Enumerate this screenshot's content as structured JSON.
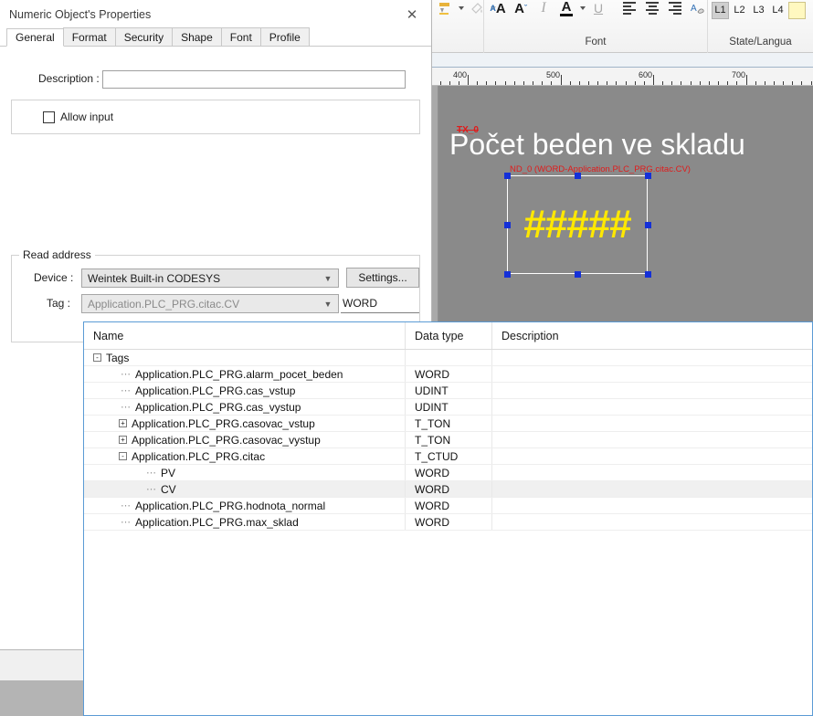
{
  "ribbon": {
    "groups": [
      {
        "label": "",
        "icons": [
          "highlight-color-icon",
          "fill-color-icon"
        ]
      },
      {
        "label": "Font",
        "icons": [
          "increase-font-size-icon",
          "decrease-font-size-icon",
          "italic-icon",
          "font-color-icon",
          "underline-icon",
          "align-left-icon",
          "align-center-icon",
          "align-right-icon",
          "format-painter-icon"
        ]
      },
      {
        "label": "State/Langua",
        "icons": [
          "L1",
          "L2",
          "L3",
          "L4"
        ]
      }
    ],
    "font_group_label": "Font",
    "state_group_label": "State/Langua",
    "state_buttons": [
      "L1",
      "L2",
      "L3",
      "L4"
    ],
    "state_active": "L1"
  },
  "ruler": {
    "labels": [
      "400",
      "500",
      "600",
      "700"
    ],
    "unit": "px"
  },
  "canvas": {
    "hmi_title": "Počet beden ve skladu",
    "text_object_label": "TX_0",
    "numeric_object_label": "ND_0 (WORD-Application.PLC_PRG.citac.CV)",
    "numeric_value_display": "#####",
    "value_color": "#ffe800",
    "annotation_color": "#e01b1b",
    "background_color": "#8a8a8a"
  },
  "dialog": {
    "title": "Numeric Object's Properties",
    "close_icon": "✕",
    "tabs": [
      {
        "label": "General",
        "active": true
      },
      {
        "label": "Format",
        "active": false
      },
      {
        "label": "Security",
        "active": false
      },
      {
        "label": "Shape",
        "active": false
      },
      {
        "label": "Font",
        "active": false
      },
      {
        "label": "Profile",
        "active": false
      }
    ],
    "description_label": "Description :",
    "description_value": "",
    "description_placeholder": "",
    "allow_input_label": "Allow input",
    "allow_input_checked": false,
    "read_address": {
      "group_label": "Read address",
      "device_label": "Device :",
      "device_value": "Weintek Built-in CODESYS",
      "settings_button": "Settings...",
      "tag_label": "Tag :",
      "tag_value": "Application.PLC_PRG.citac.CV",
      "data_type_value": "WORD"
    }
  },
  "tag_list": {
    "columns": [
      "Name",
      "Data type",
      "Description"
    ],
    "rows": [
      {
        "name": "Tags",
        "type": "",
        "desc": "",
        "depth": 0,
        "expander": "-",
        "selected": false
      },
      {
        "name": "Application.PLC_PRG.alarm_pocet_beden",
        "type": "WORD",
        "desc": "",
        "depth": 1,
        "expander": "",
        "selected": false
      },
      {
        "name": "Application.PLC_PRG.cas_vstup",
        "type": "UDINT",
        "desc": "",
        "depth": 1,
        "expander": "",
        "selected": false
      },
      {
        "name": "Application.PLC_PRG.cas_vystup",
        "type": "UDINT",
        "desc": "",
        "depth": 1,
        "expander": "",
        "selected": false
      },
      {
        "name": "Application.PLC_PRG.casovac_vstup",
        "type": "T_TON",
        "desc": "",
        "depth": 1,
        "expander": "+",
        "selected": false
      },
      {
        "name": "Application.PLC_PRG.casovac_vystup",
        "type": "T_TON",
        "desc": "",
        "depth": 1,
        "expander": "+",
        "selected": false
      },
      {
        "name": "Application.PLC_PRG.citac",
        "type": "T_CTUD",
        "desc": "",
        "depth": 1,
        "expander": "-",
        "selected": false
      },
      {
        "name": "PV",
        "type": "WORD",
        "desc": "",
        "depth": 2,
        "expander": "",
        "selected": false
      },
      {
        "name": "CV",
        "type": "WORD",
        "desc": "",
        "depth": 2,
        "expander": "",
        "selected": true
      },
      {
        "name": "Application.PLC_PRG.hodnota_normal",
        "type": "WORD",
        "desc": "",
        "depth": 1,
        "expander": "",
        "selected": false
      },
      {
        "name": "Application.PLC_PRG.max_sklad",
        "type": "WORD",
        "desc": "",
        "depth": 1,
        "expander": "",
        "selected": false
      }
    ],
    "border_color": "#5b9bd5",
    "selected_row_color": "#f0f0f0"
  }
}
